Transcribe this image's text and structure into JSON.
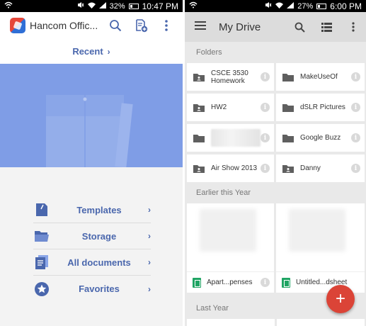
{
  "left": {
    "status": {
      "battery": "32%",
      "time": "10:47 PM"
    },
    "app_title": "Hancom Offic...",
    "recent_label": "Recent",
    "menu": [
      {
        "label": "Templates",
        "icon": "template-icon"
      },
      {
        "label": "Storage",
        "icon": "folder-open-icon"
      },
      {
        "label": "All documents",
        "icon": "documents-icon"
      },
      {
        "label": "Favorites",
        "icon": "star-icon"
      }
    ]
  },
  "right": {
    "status": {
      "battery": "27%",
      "time": "6:00 PM"
    },
    "title": "My Drive",
    "sections": {
      "folders": "Folders",
      "earlier": "Earlier this Year",
      "last_year": "Last Year"
    },
    "folders": [
      {
        "name": "CSCE 3530 Homework",
        "shared": true
      },
      {
        "name": "MakeUseOf",
        "shared": false
      },
      {
        "name": "HW2",
        "shared": true
      },
      {
        "name": "dSLR Pictures",
        "shared": false
      },
      {
        "name": "",
        "shared": false,
        "blurred": true
      },
      {
        "name": "Google Buzz",
        "shared": false
      },
      {
        "name": "Air Show 2013",
        "shared": true
      },
      {
        "name": "Danny",
        "shared": true
      }
    ],
    "documents": [
      {
        "name": "Apart...penses"
      },
      {
        "name": "Untitled...dsheet"
      }
    ],
    "fab_symbol": "+"
  },
  "colors": {
    "accent_blue": "#4a67ad",
    "hero_blue": "#7f9de6",
    "fab_red": "#db4437",
    "sheets_green": "#1fa463"
  }
}
